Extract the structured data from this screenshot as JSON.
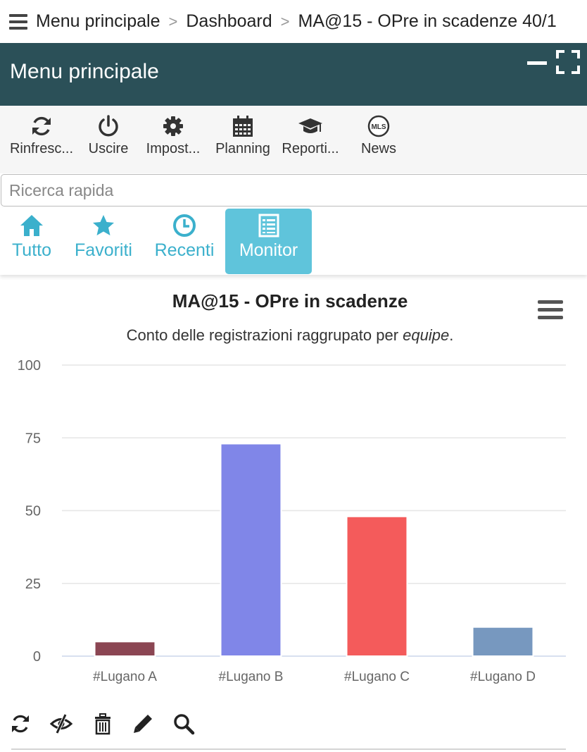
{
  "breadcrumb": {
    "items": [
      "Menu principale",
      "Dashboard",
      "MA@15 - OPre in scadenze 40/1"
    ],
    "separator": ">"
  },
  "header": {
    "title": "Menu principale"
  },
  "toolbar": {
    "items": [
      {
        "label": "Rinfresc...",
        "icon": "refresh-icon"
      },
      {
        "label": "Uscire",
        "icon": "power-icon"
      },
      {
        "label": "Impost...",
        "icon": "gear-icon"
      },
      {
        "label": "Planning",
        "icon": "calendar-icon"
      },
      {
        "label": "Reporti...",
        "icon": "graduation-cap-icon"
      },
      {
        "label": "News",
        "icon": "mls-logo-icon",
        "icon_text": "MLS"
      }
    ]
  },
  "search": {
    "placeholder": "Ricerca rapida",
    "value": ""
  },
  "tabs": [
    {
      "label": "Tutto",
      "icon": "home-icon",
      "active": false
    },
    {
      "label": "Favoriti",
      "icon": "star-icon",
      "active": false
    },
    {
      "label": "Recenti",
      "icon": "clock-icon",
      "active": false
    },
    {
      "label": "Monitor",
      "icon": "list-icon",
      "active": true
    }
  ],
  "colors": {
    "header_bg": "#2b5058",
    "accent": "#3bb0cc",
    "active_tab": "#5fc4db"
  },
  "chart_data": {
    "type": "bar",
    "title": "MA@15 - OPre in scadenze",
    "subtitle_prefix": "Conto delle registrazioni raggrupato per ",
    "subtitle_emphasis": "equipe",
    "subtitle_suffix": ".",
    "categories": [
      "#Lugano A",
      "#Lugano B",
      "#Lugano C",
      "#Lugano D"
    ],
    "values": [
      5,
      73,
      48,
      10
    ],
    "colors": [
      "#8b4653",
      "#8086e8",
      "#f45b5b",
      "#7798bf"
    ],
    "ylim": [
      0,
      100
    ],
    "yticks": [
      0,
      25,
      50,
      75,
      100
    ],
    "grid": true,
    "legend": "none"
  },
  "chart_actions": [
    {
      "icon": "refresh-icon"
    },
    {
      "icon": "eye-slash-icon"
    },
    {
      "icon": "trash-icon"
    },
    {
      "icon": "pencil-icon"
    },
    {
      "icon": "search-icon"
    }
  ]
}
